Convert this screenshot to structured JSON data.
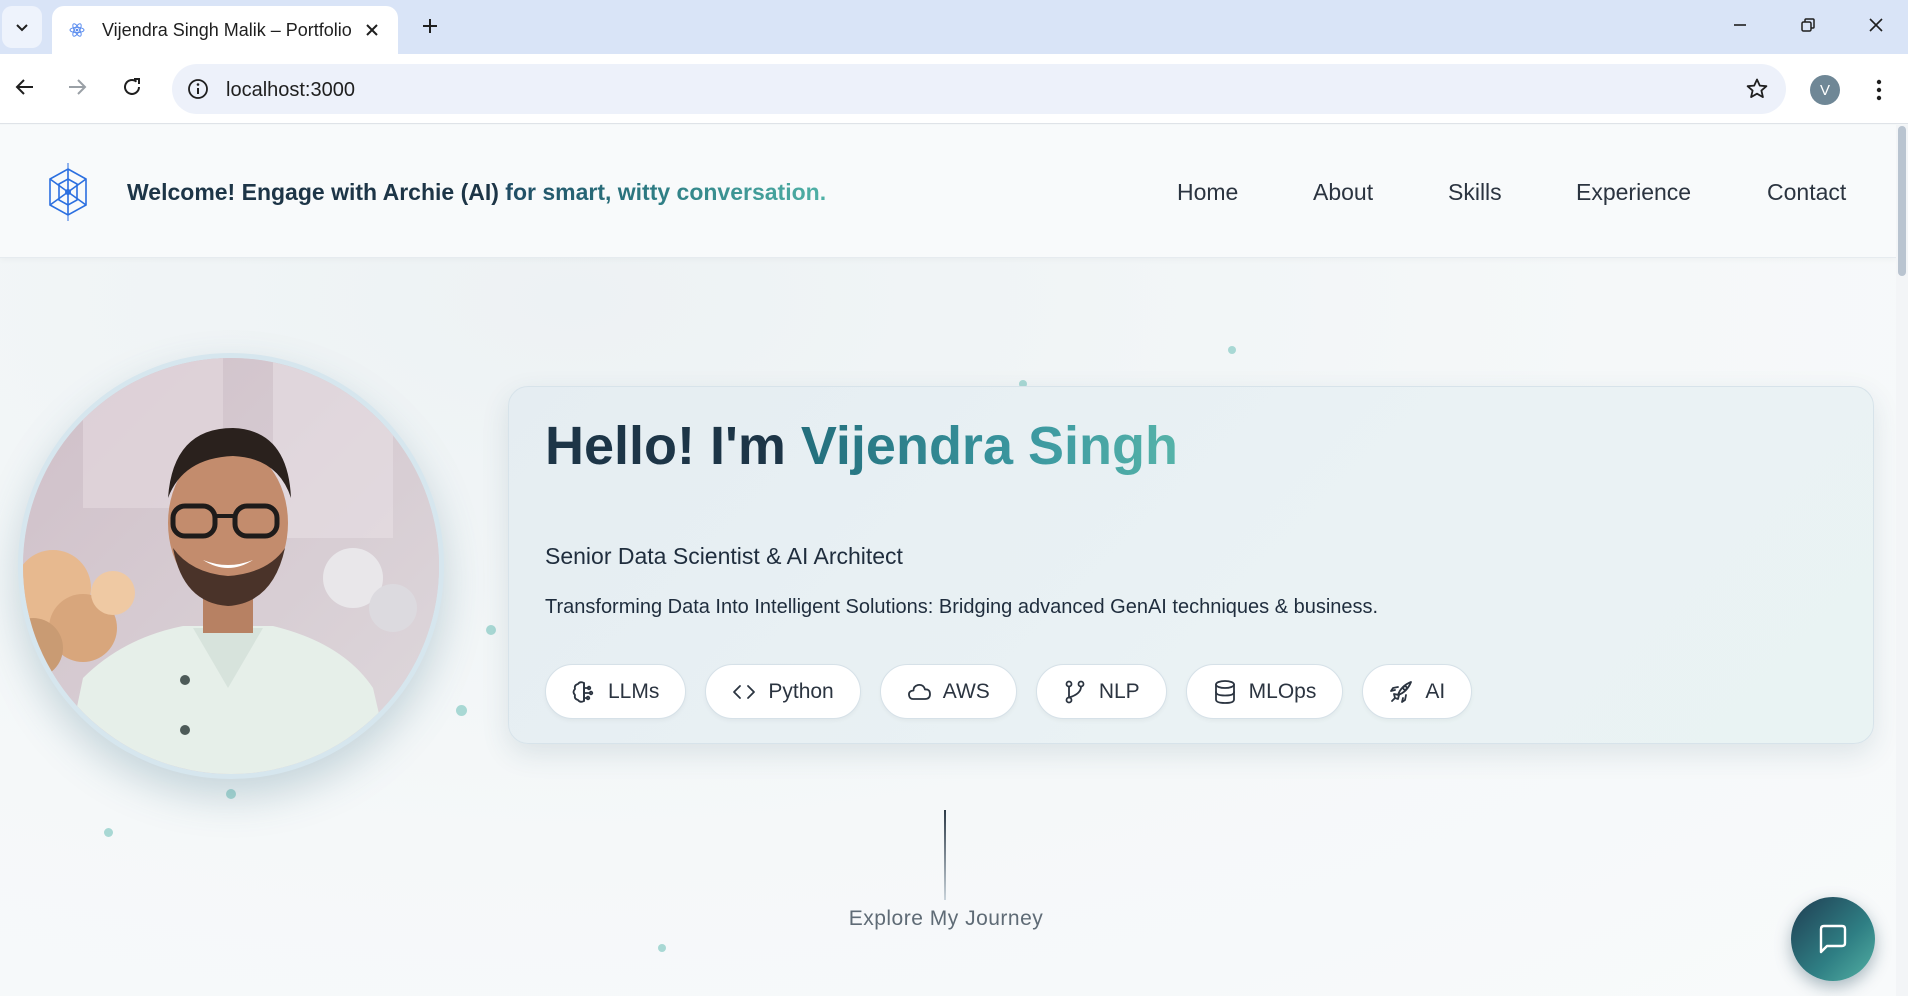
{
  "browser": {
    "tab_title": "Vijendra Singh Malik – Portfolio",
    "url": "localhost:3000",
    "profile_initial": "V"
  },
  "header": {
    "welcome_prefix": "Welcome! Engage with Archie (AI) ",
    "welcome_highlight": "for smart, witty conversation.",
    "nav": [
      {
        "label": "Home"
      },
      {
        "label": "About"
      },
      {
        "label": "Skills"
      },
      {
        "label": "Experience"
      },
      {
        "label": "Contact"
      }
    ]
  },
  "hero": {
    "greeting": "Hello! I'm ",
    "name": "Vijendra Singh",
    "role": "Senior Data Scientist & AI Architect",
    "tagline": "Transforming Data Into Intelligent Solutions: Bridging advanced GenAI techniques & business.",
    "skills": [
      {
        "label": "LLMs",
        "icon": "brain-icon"
      },
      {
        "label": "Python",
        "icon": "code-icon"
      },
      {
        "label": "AWS",
        "icon": "cloud-icon"
      },
      {
        "label": "NLP",
        "icon": "git-branch-icon"
      },
      {
        "label": "MLOps",
        "icon": "database-icon"
      },
      {
        "label": "AI",
        "icon": "rocket-icon"
      }
    ]
  },
  "scroll_hint": "Explore My Journey",
  "colors": {
    "accent_teal": "#3b98a0",
    "navy": "#1d3547",
    "tabstrip": "#d9e4f7"
  }
}
